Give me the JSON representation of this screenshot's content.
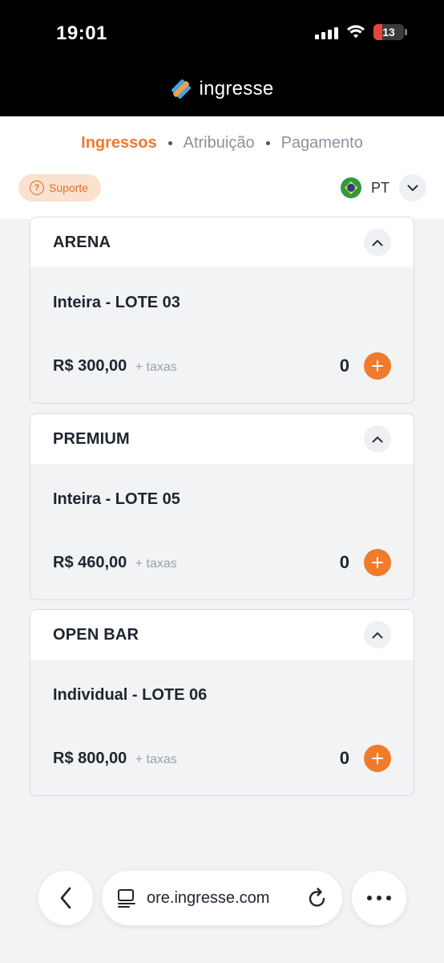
{
  "status_bar": {
    "time": "19:01",
    "battery": "13"
  },
  "brand": {
    "name": "ingresse"
  },
  "steps": {
    "active": "Ingressos",
    "second": "Atribuição",
    "third": "Pagamento"
  },
  "support": {
    "label": "Suporte",
    "icon": "question-icon"
  },
  "language": {
    "code": "PT",
    "flag": "brazil-flag-icon"
  },
  "tickets": [
    {
      "title": "ARENA",
      "lote": "Inteira - LOTE 03",
      "price": "R$ 300,00",
      "taxes": "+ taxas",
      "quantity": "0"
    },
    {
      "title": "PREMIUM",
      "lote": "Inteira - LOTE 05",
      "price": "R$ 460,00",
      "taxes": "+ taxas",
      "quantity": "0"
    },
    {
      "title": "OPEN BAR",
      "lote": "Individual - LOTE 06",
      "price": "R$ 800,00",
      "taxes": "+ taxas",
      "quantity": "0"
    }
  ],
  "browser": {
    "url": "ore.ingresse.com"
  },
  "colors": {
    "accent": "#ee7a2d",
    "header": "#000000",
    "background": "#f2f3f5"
  }
}
